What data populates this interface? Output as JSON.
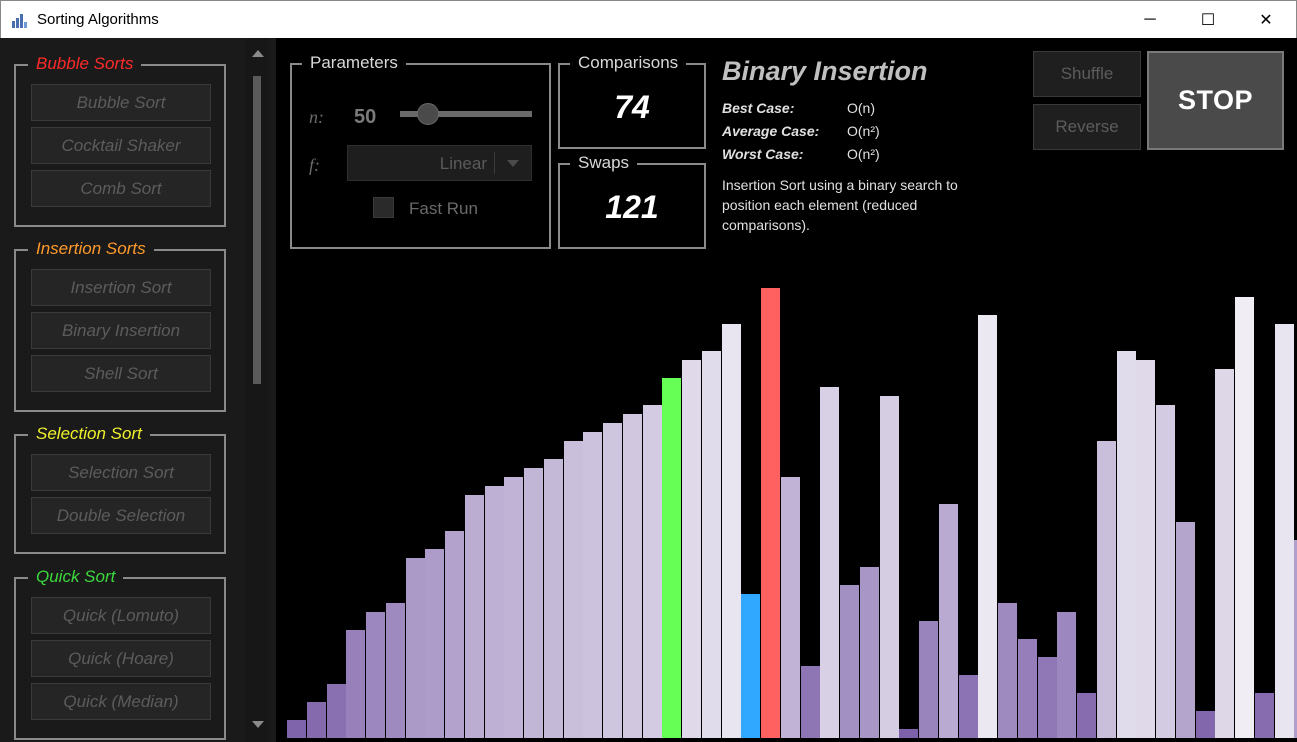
{
  "window": {
    "title": "Sorting Algorithms",
    "controls": {
      "minimize": "─",
      "maximize": "☐",
      "close": "✕"
    }
  },
  "sidebar": {
    "groups": [
      {
        "title": "Bubble Sorts",
        "color": "#ff2a2a",
        "items": [
          "Bubble Sort",
          "Cocktail Shaker",
          "Comb Sort"
        ]
      },
      {
        "title": "Insertion Sorts",
        "color": "#ff9a2a",
        "items": [
          "Insertion Sort",
          "Binary Insertion",
          "Shell Sort"
        ]
      },
      {
        "title": "Selection Sort",
        "color": "#f0f02a",
        "items": [
          "Selection Sort",
          "Double Selection"
        ]
      },
      {
        "title": "Quick Sort",
        "color": "#3cd83c",
        "items": [
          "Quick (Lomuto)",
          "Quick (Hoare)",
          "Quick (Median)"
        ]
      }
    ]
  },
  "parameters": {
    "title": "Parameters",
    "n_label": "n:",
    "n_value": "50",
    "f_label": "f:",
    "f_value": "Linear",
    "fast_run_label": "Fast Run",
    "fast_run_checked": false
  },
  "counters": {
    "comparisons_label": "Comparisons",
    "comparisons_value": "74",
    "swaps_label": "Swaps",
    "swaps_value": "121"
  },
  "algorithm": {
    "name": "Binary Insertion",
    "best_label": "Best Case:",
    "best_value": "O(n)",
    "average_label": "Average Case:",
    "average_value": "O(n²)",
    "worst_label": "Worst Case:",
    "worst_value": "O(n²)",
    "description": "Insertion Sort using a binary search to position each element (reduced comparisons)."
  },
  "controls": {
    "shuffle_label": "Shuffle",
    "reverse_label": "Reverse",
    "stop_label": "STOP"
  },
  "colors": {
    "compare": "#66ff55",
    "current": "#ff6060",
    "key": "#30a8ff",
    "bar_low": "#7b5ea8",
    "bar_high": "#f2f1f6"
  },
  "bars": {
    "max": 50,
    "values": [
      2,
      4,
      6,
      12,
      14,
      15,
      20,
      21,
      23,
      27,
      28,
      29,
      30,
      31,
      33,
      34,
      35,
      36,
      37,
      40,
      42,
      43,
      46,
      16,
      50,
      29,
      8,
      39,
      17,
      19,
      38,
      1,
      13,
      26,
      7,
      47,
      15,
      11,
      9,
      14,
      5,
      33,
      43,
      42,
      37,
      24,
      3,
      41,
      49,
      5,
      46,
      22
    ],
    "highlights": {
      "19": "compare",
      "23": "key",
      "24": "current"
    }
  }
}
